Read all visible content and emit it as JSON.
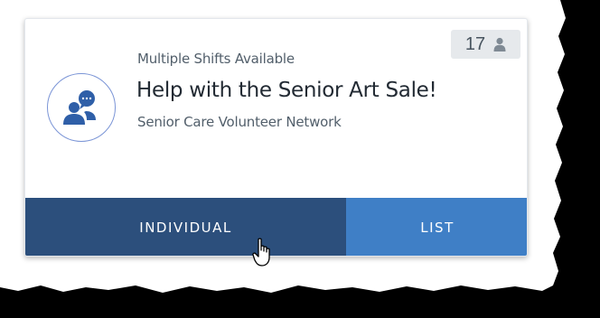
{
  "card": {
    "shift_label": "Multiple Shifts Available",
    "title": "Help with the Senior Art Sale!",
    "organization": "Senior Care Volunteer Network",
    "count": "17",
    "count_icon": "person-icon",
    "avatar_icon": "chat-people-icon"
  },
  "actions": {
    "individual_label": "INDIVIDUAL",
    "list_label": "LIST"
  },
  "colors": {
    "individual_bg": "#2c4f7c",
    "list_bg": "#3f7fc6",
    "avatar_accent": "#2f5fa8"
  }
}
